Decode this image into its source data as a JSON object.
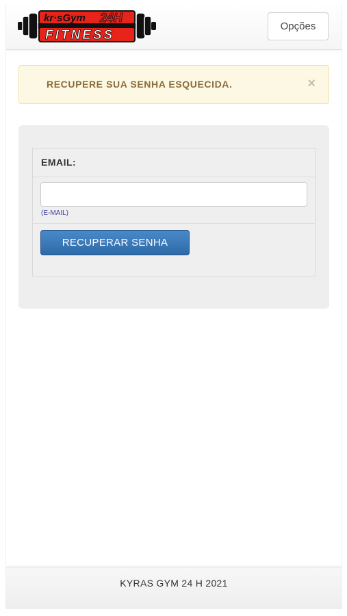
{
  "navbar": {
    "logo": {
      "line1": "kr·sGym",
      "badge": "24H",
      "line2": "FITNESS",
      "icon": "dumbbell-logo-icon",
      "colors": {
        "red": "#e8231a",
        "black": "#111111"
      }
    },
    "options_label": "Opções"
  },
  "alert": {
    "message": "RECUPERE SUA SENHA ESQUECIDA.",
    "close_symbol": "×",
    "close_icon": "close-icon"
  },
  "form": {
    "email_label": "EMAIL:",
    "email_value": "",
    "email_help": "(E-MAIL)",
    "submit_label": "RECUPERAR SENHA"
  },
  "footer": {
    "text": "KYRAS GYM 24 H 2021"
  },
  "colors": {
    "alert_bg": "#fcf8e3",
    "alert_text": "#8a6d3b",
    "primary_button": "#337ab7",
    "panel_bg": "#eeeeee"
  }
}
